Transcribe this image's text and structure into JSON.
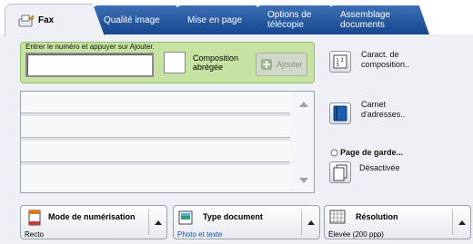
{
  "tabs": [
    {
      "label": "Fax",
      "active": true
    },
    {
      "label": "Qualité image"
    },
    {
      "label": "Mise en page"
    },
    {
      "label": "Options de télécopie"
    },
    {
      "label": "Assemblage documents"
    }
  ],
  "entry": {
    "instruction": "Entrer le numéro et appuyer sur Ajouter.",
    "compo_label": "Composition abrégée",
    "add_label": "Ajouter"
  },
  "side": {
    "caract_label": "Caract. de composition..",
    "carnet_label": "Carnet d'adresses..",
    "page_garde_label": "Page de garde...",
    "page_garde_value": "Désactivée"
  },
  "bottom": [
    {
      "title": "Mode de numérisation",
      "value": "Recto"
    },
    {
      "title": "Type document",
      "value": "Photo et texte"
    },
    {
      "title": "Résolution",
      "value": "Élevée (200 ppp)"
    }
  ],
  "colors": {
    "tab_blue": "#1f4f97",
    "entry_green": "#c6e3a1",
    "value_blue": "#1a4fa3"
  }
}
